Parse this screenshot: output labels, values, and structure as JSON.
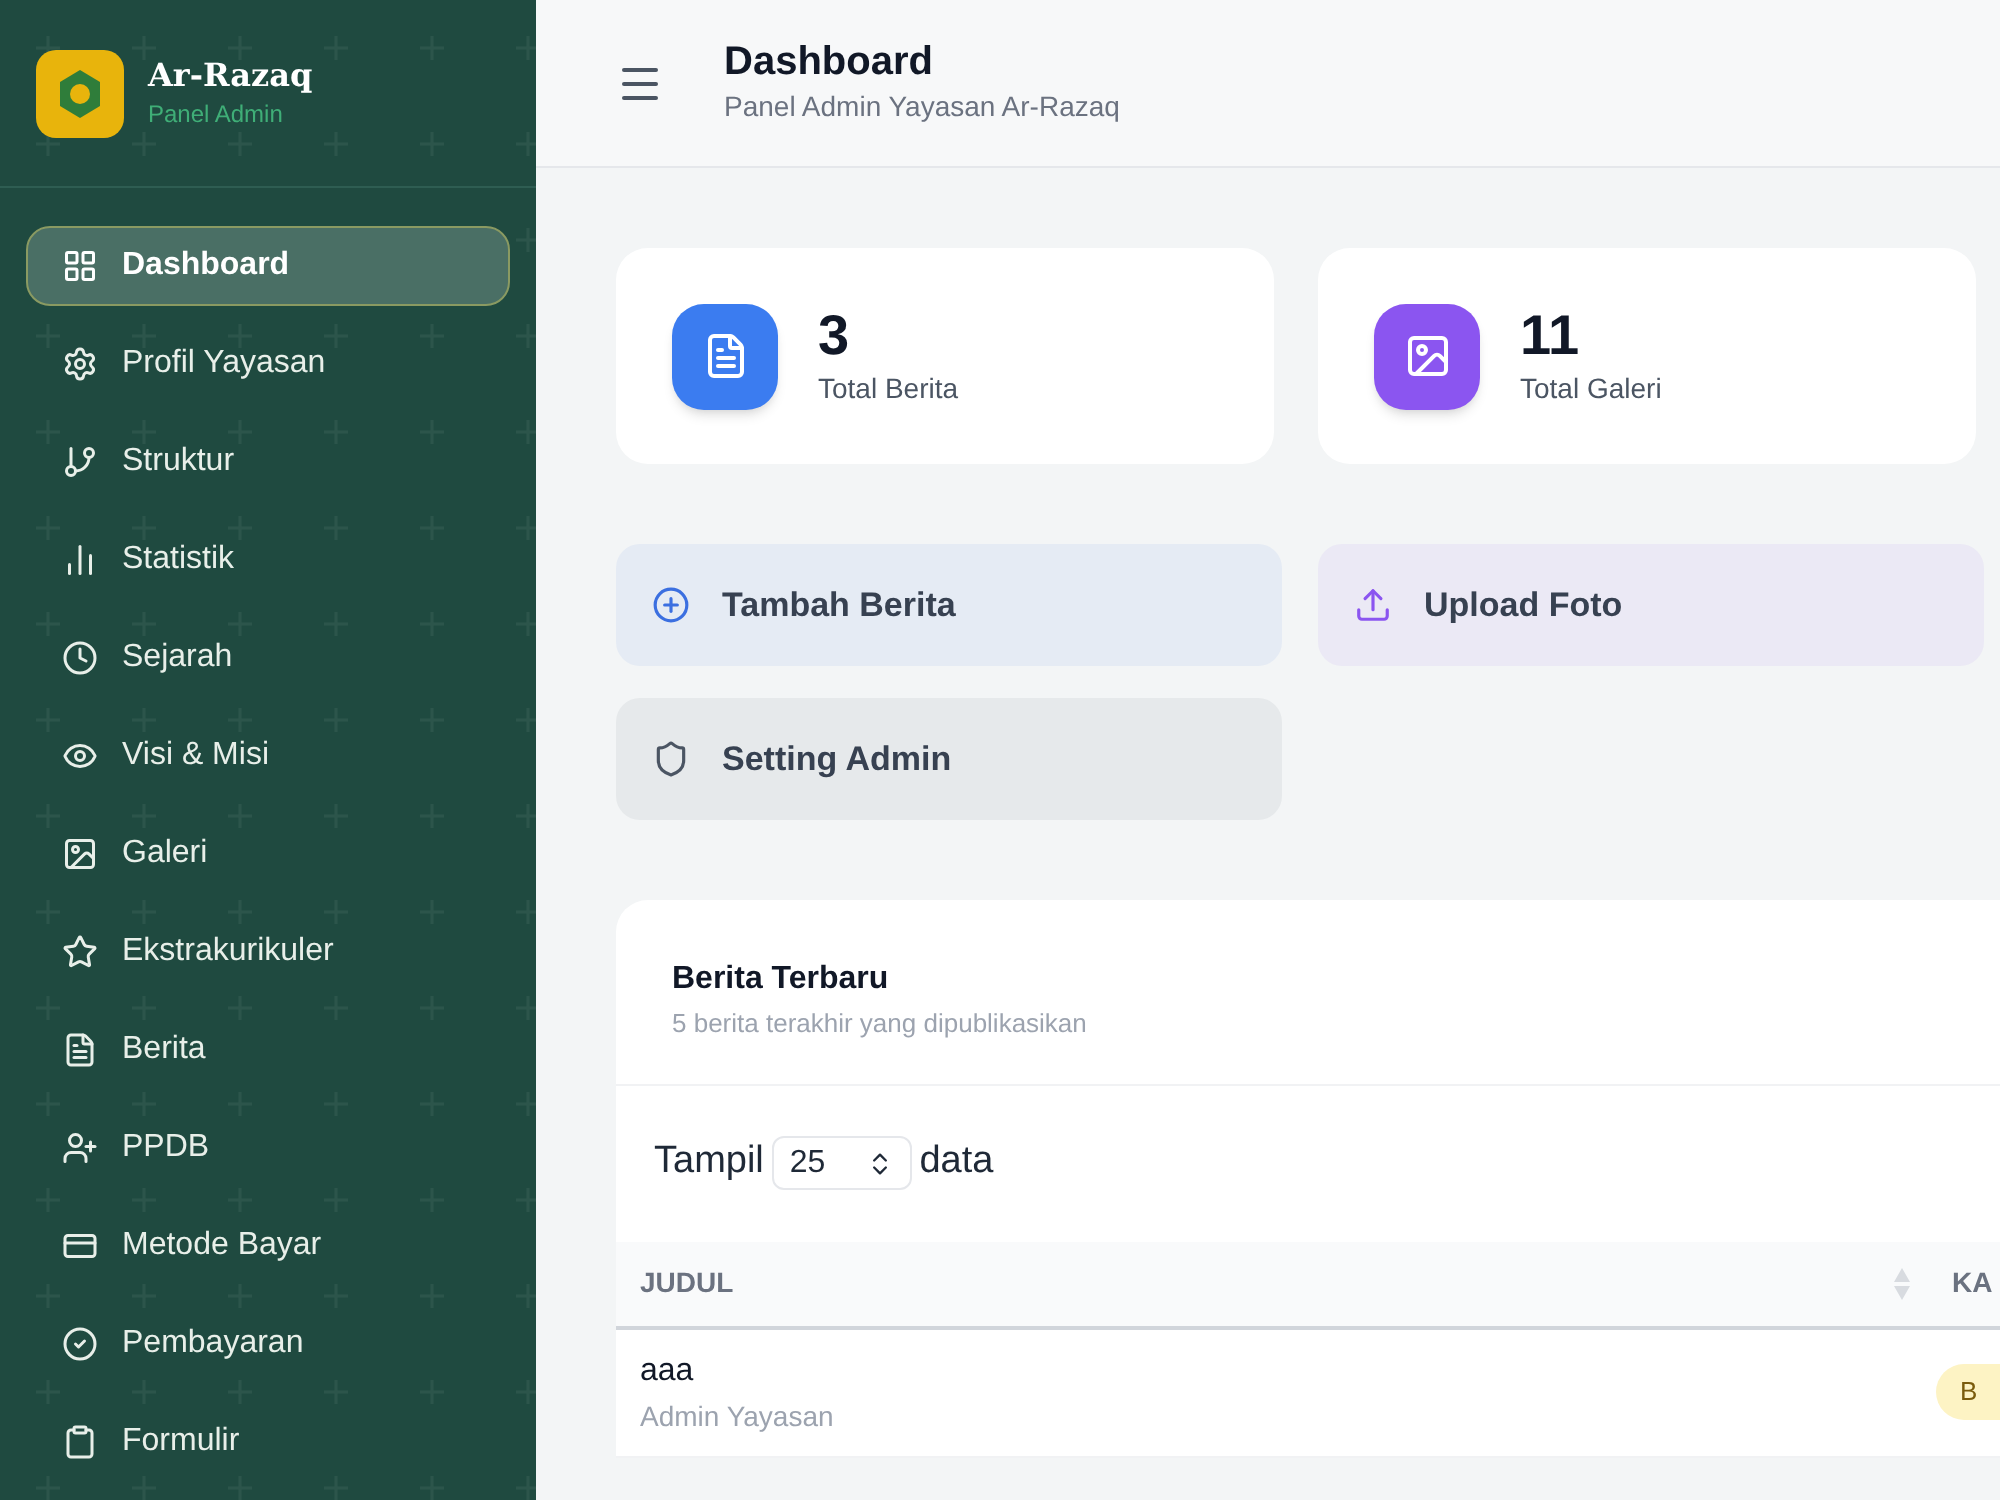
{
  "brand": {
    "title": "Ar-Razaq",
    "subtitle": "Panel Admin"
  },
  "sidebar": {
    "items": [
      {
        "label": "Dashboard",
        "selected": true
      },
      {
        "label": "Profil Yayasan",
        "selected": false
      },
      {
        "label": "Struktur",
        "selected": false
      },
      {
        "label": "Statistik",
        "selected": false
      },
      {
        "label": "Sejarah",
        "selected": false
      },
      {
        "label": "Visi & Misi",
        "selected": false
      },
      {
        "label": "Galeri",
        "selected": false
      },
      {
        "label": "Ekstrakurikuler",
        "selected": false
      },
      {
        "label": "Berita",
        "selected": false
      },
      {
        "label": "PPDB",
        "selected": false
      },
      {
        "label": "Metode Bayar",
        "selected": false
      },
      {
        "label": "Pembayaran",
        "selected": false
      },
      {
        "label": "Formulir",
        "selected": false
      }
    ]
  },
  "header": {
    "title": "Dashboard",
    "subtitle": "Panel Admin Yayasan Ar-Razaq"
  },
  "stats": [
    {
      "value": "3",
      "label": "Total Berita",
      "color": "#3b7cf0"
    },
    {
      "value": "11",
      "label": "Total Galeri",
      "color": "#8b55f0"
    }
  ],
  "quick_actions": [
    {
      "label": "Tambah Berita",
      "color": "#3b6fe0"
    },
    {
      "label": "Upload Foto",
      "color": "#8b55f0"
    },
    {
      "label": "Setting Admin",
      "color": "#4b5563"
    }
  ],
  "news": {
    "title": "Berita Terbaru",
    "subtitle": "5 berita terakhir yang dipublikasikan",
    "show_prefix": "Tampil",
    "page_size": "25",
    "show_suffix": "data",
    "columns": [
      "JUDUL",
      "KA"
    ],
    "rows": [
      {
        "title": "aaa",
        "author": "Admin Yayasan",
        "badge": "B"
      }
    ]
  }
}
